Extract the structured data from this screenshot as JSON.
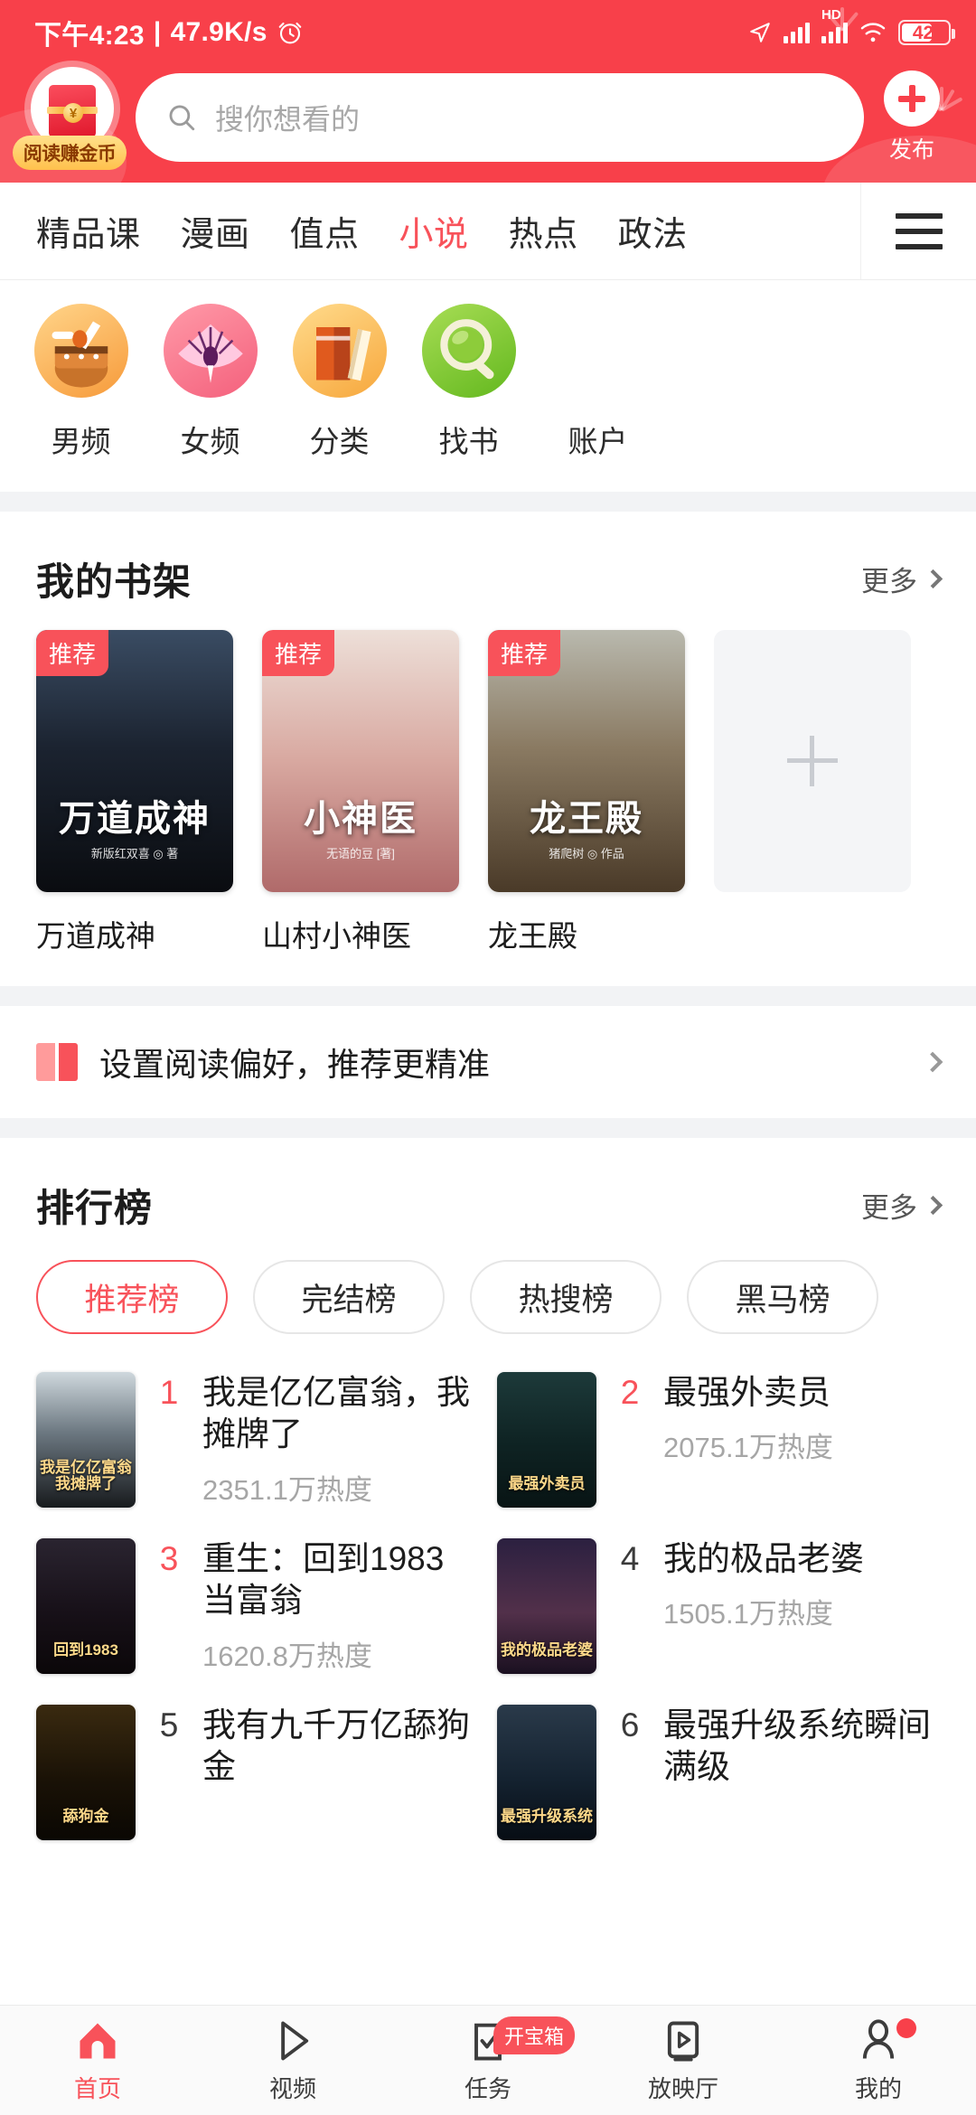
{
  "status_bar": {
    "time": "下午4:23",
    "separator": "|",
    "net_speed": "47.9K/s",
    "alarm_icon": "alarm-clock-icon",
    "location_icon": "location-arrow-icon",
    "signal_icon": "signal-bars-icon",
    "hd_label": "HD",
    "signal2_icon": "signal-bars-icon",
    "wifi_icon": "wifi-icon",
    "battery_level": "42"
  },
  "header": {
    "logo": {
      "badge_label": "阅读赚金币",
      "envelope_icon": "red-envelope-icon",
      "coin_symbol": "¥"
    },
    "search": {
      "icon": "search-icon",
      "placeholder": "搜你想看的",
      "value": ""
    },
    "publish": {
      "icon": "plus-icon",
      "label": "发布"
    }
  },
  "nav_tabs": {
    "items": [
      {
        "label": "精品课",
        "active": false
      },
      {
        "label": "漫画",
        "active": false
      },
      {
        "label": "值点",
        "active": false
      },
      {
        "label": "小说",
        "active": true
      },
      {
        "label": "热点",
        "active": false
      },
      {
        "label": "政法",
        "active": false
      }
    ],
    "menu_icon": "hamburger-menu-icon"
  },
  "categories": [
    {
      "label": "男频",
      "icon": "drum-brush-icon"
    },
    {
      "label": "女频",
      "icon": "fan-icon"
    },
    {
      "label": "分类",
      "icon": "books-icon"
    },
    {
      "label": "找书",
      "icon": "magnifier-icon"
    },
    {
      "label": "账户",
      "icon": ""
    }
  ],
  "bookshelf": {
    "title": "我的书架",
    "more_label": "更多",
    "more_icon": "chevron-right-icon",
    "books": [
      {
        "name": "万道成神",
        "badge": "推荐",
        "cover_title": "万道成神",
        "cover_author": "新版红双喜 ◎ 著"
      },
      {
        "name": "山村小神医",
        "badge": "推荐",
        "cover_title": "小神医",
        "cover_author": "无语的豆 [著]"
      },
      {
        "name": "龙王殿",
        "badge": "推荐",
        "cover_title": "龙王殿",
        "cover_author": "猪爬树 ◎ 作品"
      }
    ],
    "add_slot": {
      "icon": "plus-icon"
    }
  },
  "preference_banner": {
    "icon": "open-book-icon",
    "text": "设置阅读偏好，推荐更精准",
    "chevron": "chevron-right-icon"
  },
  "ranking": {
    "title": "排行榜",
    "more_label": "更多",
    "more_icon": "chevron-right-icon",
    "chips": [
      {
        "label": "推荐榜",
        "active": true
      },
      {
        "label": "完结榜",
        "active": false
      },
      {
        "label": "热搜榜",
        "active": false
      },
      {
        "label": "黑马榜",
        "active": false
      }
    ],
    "items": [
      {
        "rank": "1",
        "title": "我是亿亿富翁，我摊牌了",
        "heat": "2351.1万热度",
        "cover_title": "我是亿亿富翁 我摊牌了"
      },
      {
        "rank": "2",
        "title": "最强外卖员",
        "heat": "2075.1万热度",
        "cover_title": "最强外卖员"
      },
      {
        "rank": "3",
        "title": "重生：回到1983当富翁",
        "heat": "1620.8万热度",
        "cover_title": "回到1983"
      },
      {
        "rank": "4",
        "title": "我的极品老婆",
        "heat": "1505.1万热度",
        "cover_title": "我的极品老婆"
      },
      {
        "rank": "5",
        "title": "我有九千万亿舔狗金",
        "heat": "",
        "cover_title": "舔狗金"
      },
      {
        "rank": "6",
        "title": "最强升级系统瞬间满级",
        "heat": "",
        "cover_title": "最强升级系统"
      }
    ]
  },
  "bottom_nav": {
    "items": [
      {
        "label": "首页",
        "icon": "home-icon",
        "active": true,
        "badge": "",
        "dot": false
      },
      {
        "label": "视频",
        "icon": "play-icon",
        "active": false,
        "badge": "",
        "dot": false
      },
      {
        "label": "任务",
        "icon": "task-icon",
        "active": false,
        "badge": "开宝箱",
        "dot": false
      },
      {
        "label": "放映厅",
        "icon": "cinema-icon",
        "active": false,
        "badge": "",
        "dot": false
      },
      {
        "label": "我的",
        "icon": "person-icon",
        "active": false,
        "badge": "",
        "dot": true
      }
    ]
  },
  "colors": {
    "brand_red": "#f8404a",
    "accent_red": "#f8525a",
    "bg_gray": "#f2f3f5",
    "text_dark": "#1c1c1c",
    "text_muted": "#a6a6a6"
  }
}
